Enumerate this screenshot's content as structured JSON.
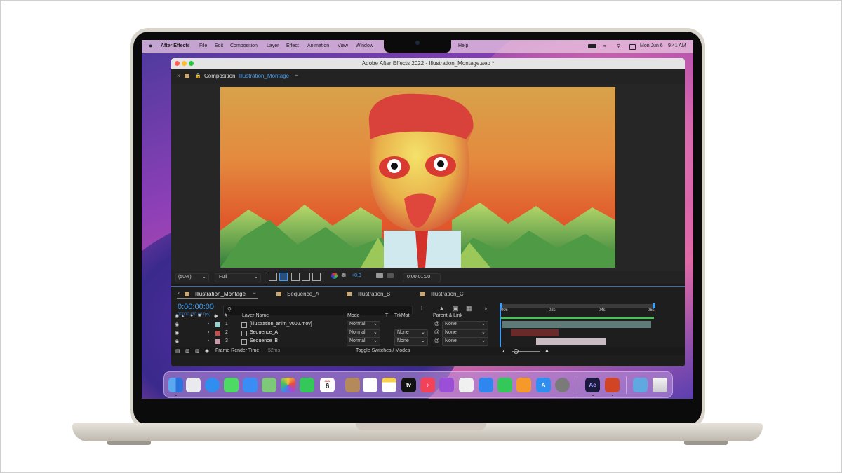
{
  "menubar": {
    "app": "After Effects",
    "items": [
      "File",
      "Edit",
      "Composition",
      "Layer",
      "Effect",
      "Animation",
      "View",
      "Window",
      "Help"
    ],
    "date": "Mon Jun 6",
    "time": "9:41 AM"
  },
  "window": {
    "title": "Adobe After Effects 2022 - Illustration_Montage.aep *"
  },
  "composition_panel": {
    "label": "Composition",
    "name": "Illustration_Montage"
  },
  "viewer_controls": {
    "zoom": "(50%)",
    "resolution": "Full",
    "exposure": "+0.0",
    "timecode": "0:00:01:00"
  },
  "timeline": {
    "tabs": [
      "Illustration_Montage",
      "Sequence_A",
      "Illustration_B",
      "Illustration_C"
    ],
    "current_time": "0:00:00:00",
    "frame_info": "00000 (30.00 fps)",
    "ruler": [
      "00s",
      "02s",
      "04s",
      "06s"
    ],
    "columns": {
      "number": "#",
      "layer_name": "Layer Name",
      "mode": "Mode",
      "t": "T",
      "trkmat": "TrkMat",
      "parent": "Parent & Link"
    },
    "layers": [
      {
        "num": "1",
        "name": "[illustration_anim_v002.mov]",
        "mode": "Normal",
        "trkmat": "",
        "parent": "None",
        "color": "#9ad0d0"
      },
      {
        "num": "2",
        "name": "Sequence_A",
        "mode": "Normal",
        "trkmat": "None",
        "parent": "None",
        "color": "#c05050"
      },
      {
        "num": "3",
        "name": "Sequence_B",
        "mode": "Normal",
        "trkmat": "None",
        "parent": "None",
        "color": "#c89aa8"
      }
    ],
    "footer": {
      "render_label": "Frame Render Time",
      "render_value": "52ms",
      "toggle": "Toggle Switches / Modes"
    }
  },
  "dock": {
    "apps": [
      "finder-icon",
      "launchpad-icon",
      "safari-icon",
      "messages-icon",
      "mail-icon",
      "maps-icon",
      "photos-icon",
      "facetime-icon",
      "calendar-icon",
      "contacts-icon",
      "reminders-icon",
      "notes-icon",
      "tv-icon",
      "music-icon",
      "podcasts-icon",
      "news-icon",
      "keynote-icon",
      "numbers-icon",
      "pages-icon",
      "app-store-icon",
      "system-preferences-icon",
      "after-effects-icon",
      "powerpoint-icon",
      "downloads-folder-icon",
      "trash-icon"
    ],
    "calendar_day": "6",
    "calendar_month": "JUN",
    "tv_label": "tv",
    "ae_label": "Ae"
  }
}
